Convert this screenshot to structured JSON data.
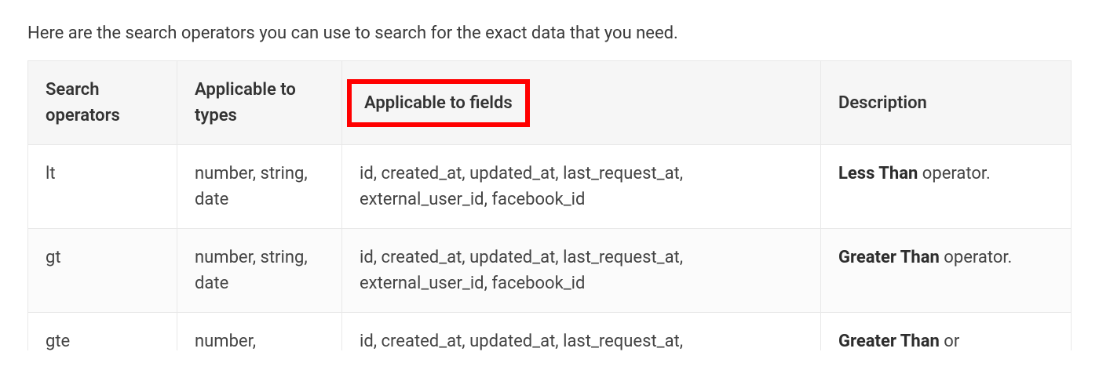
{
  "intro": "Here are the search operators you can use to search for the exact data that you need.",
  "table": {
    "headers": {
      "operators": "Search operators",
      "types": "Applicable to types",
      "fields": "Applicable to fields",
      "description": "Description"
    },
    "rows": [
      {
        "operator": "lt",
        "types": "number, string, date",
        "fields": "id, created_at, updated_at, last_request_at, external_user_id, facebook_id",
        "desc_bold": "Less Than",
        "desc_rest": " operator."
      },
      {
        "operator": "gt",
        "types": "number, string, date",
        "fields": "id, created_at, updated_at, last_request_at, external_user_id, facebook_id",
        "desc_bold": "Greater Than",
        "desc_rest": " operator."
      },
      {
        "operator": "gte",
        "types": "number,",
        "fields": "id, created_at, updated_at, last_request_at,",
        "desc_bold": "Greater Than",
        "desc_rest": " or"
      }
    ]
  }
}
